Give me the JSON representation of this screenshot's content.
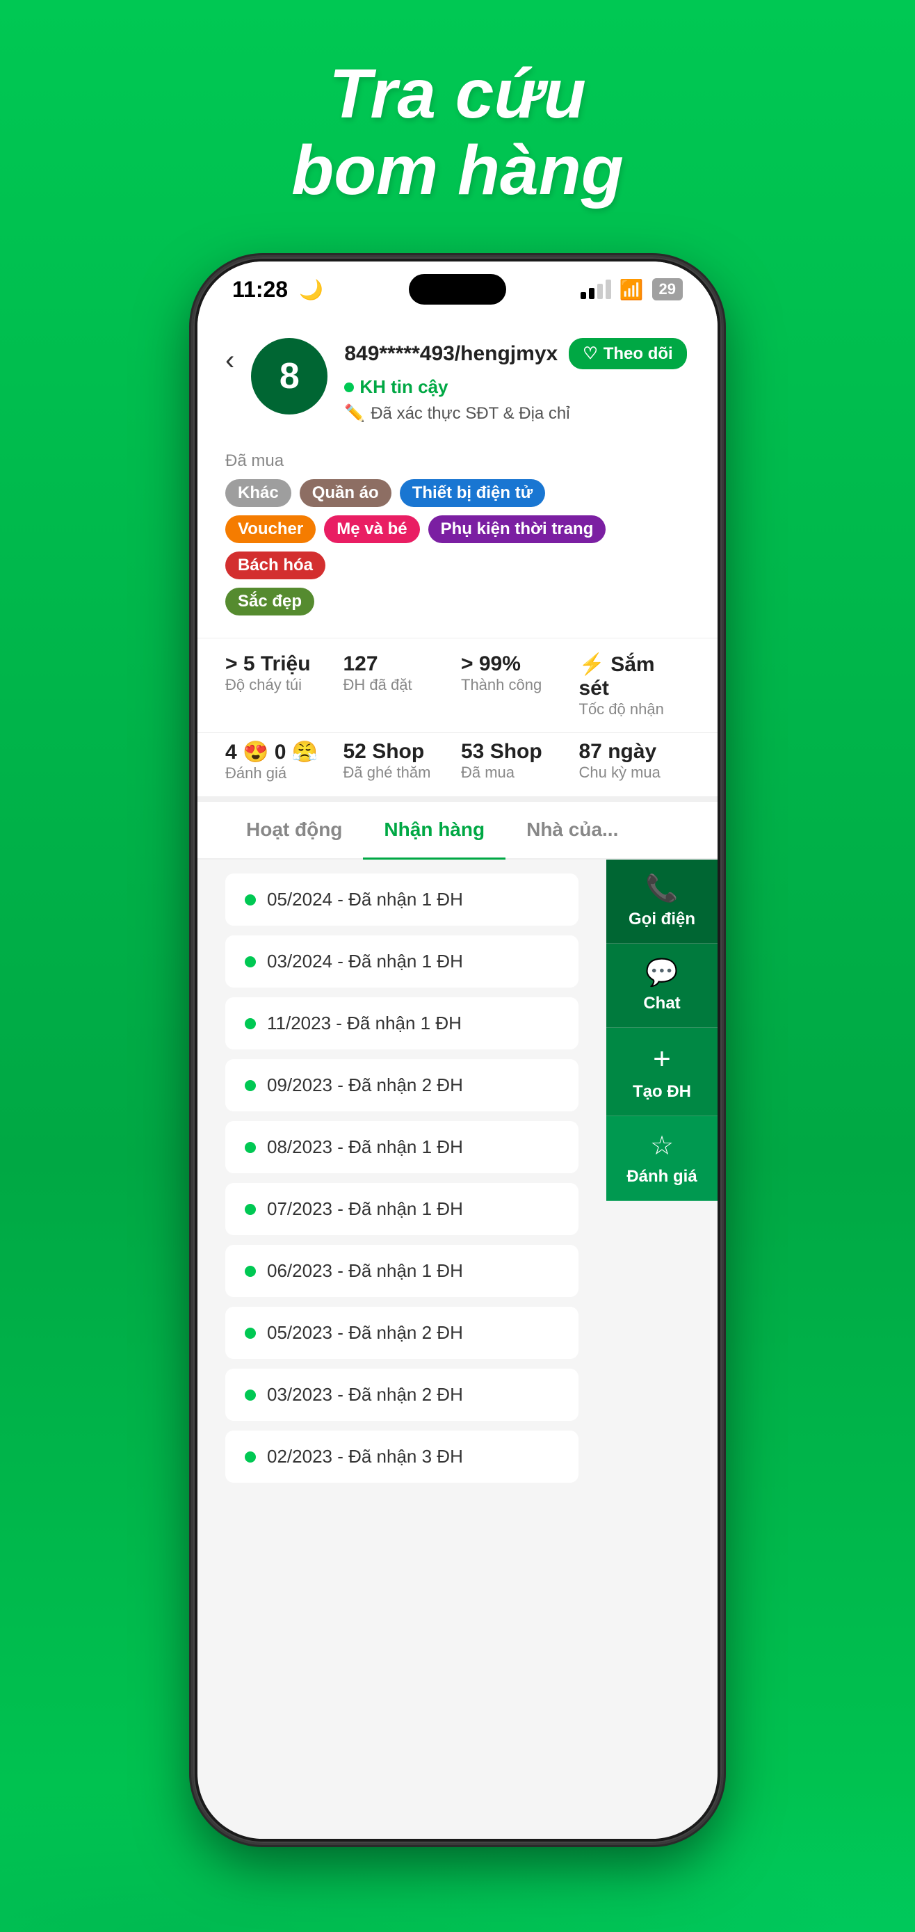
{
  "page": {
    "header": {
      "line1": "Tra cứu",
      "line2": "bom hàng"
    }
  },
  "statusBar": {
    "time": "11:28",
    "moon": "🌙",
    "battery": "29"
  },
  "profile": {
    "avatar_number": "8",
    "name": "849*****493/hengjmyx",
    "theo_doi_label": "Theo dõi",
    "kh_label": "KH tin cậy",
    "verified_label": "Đã xác thực SĐT & Địa chỉ",
    "da_mua_label": "Đã mua"
  },
  "tags": [
    {
      "label": "Khác",
      "color": "gray"
    },
    {
      "label": "Quần áo",
      "color": "olive"
    },
    {
      "label": "Thiết bị điện tử",
      "color": "blue"
    },
    {
      "label": "Voucher",
      "color": "orange"
    },
    {
      "label": "Mẹ và bé",
      "color": "pink"
    },
    {
      "label": "Phụ kiện thời trang",
      "color": "purple"
    },
    {
      "label": "Bách hóa",
      "color": "red"
    },
    {
      "label": "Sắc đẹp",
      "color": "green-dark"
    }
  ],
  "stats1": [
    {
      "value": "> 5 Triệu",
      "label": "Độ cháy túi"
    },
    {
      "value": "127",
      "label": "ĐH đã đặt"
    },
    {
      "value": "> 99%",
      "label": "Thành công"
    },
    {
      "value": "⚡ Sắm sét",
      "label": "Tốc độ nhận"
    }
  ],
  "stats2": [
    {
      "value": "4 😍 0 😤",
      "label": "Đánh giá"
    },
    {
      "value": "52 Shop",
      "label": "Đã ghé thăm"
    },
    {
      "value": "53 Shop",
      "label": "Đã mua"
    },
    {
      "value": "87 ngày",
      "label": "Chu kỳ mua"
    }
  ],
  "tabs": [
    {
      "label": "Hoạt động",
      "active": false
    },
    {
      "label": "Nhận hàng",
      "active": true
    },
    {
      "label": "Nhà của...",
      "active": false
    }
  ],
  "listItems": [
    "05/2024 - Đã nhận 1 ĐH",
    "03/2024 - Đã nhận 1 ĐH",
    "11/2023 - Đã nhận 1 ĐH",
    "09/2023 - Đã nhận 2 ĐH",
    "08/2023 - Đã nhận 1 ĐH",
    "07/2023 - Đã nhận 1 ĐH",
    "06/2023 - Đã nhận 1 ĐH",
    "05/2023 - Đã nhận 2 ĐH",
    "03/2023 - Đã nhận 2 ĐH",
    "02/2023 - Đã nhận 3 ĐH"
  ],
  "floatButtons": [
    {
      "icon": "📞",
      "label": "Gọi điện",
      "id": "goi"
    },
    {
      "icon": "💬",
      "label": "Chat",
      "id": "chat"
    },
    {
      "icon": "+",
      "label": "Tạo ĐH",
      "id": "tao"
    },
    {
      "icon": "☆",
      "label": "Đánh giá",
      "id": "danh"
    }
  ]
}
